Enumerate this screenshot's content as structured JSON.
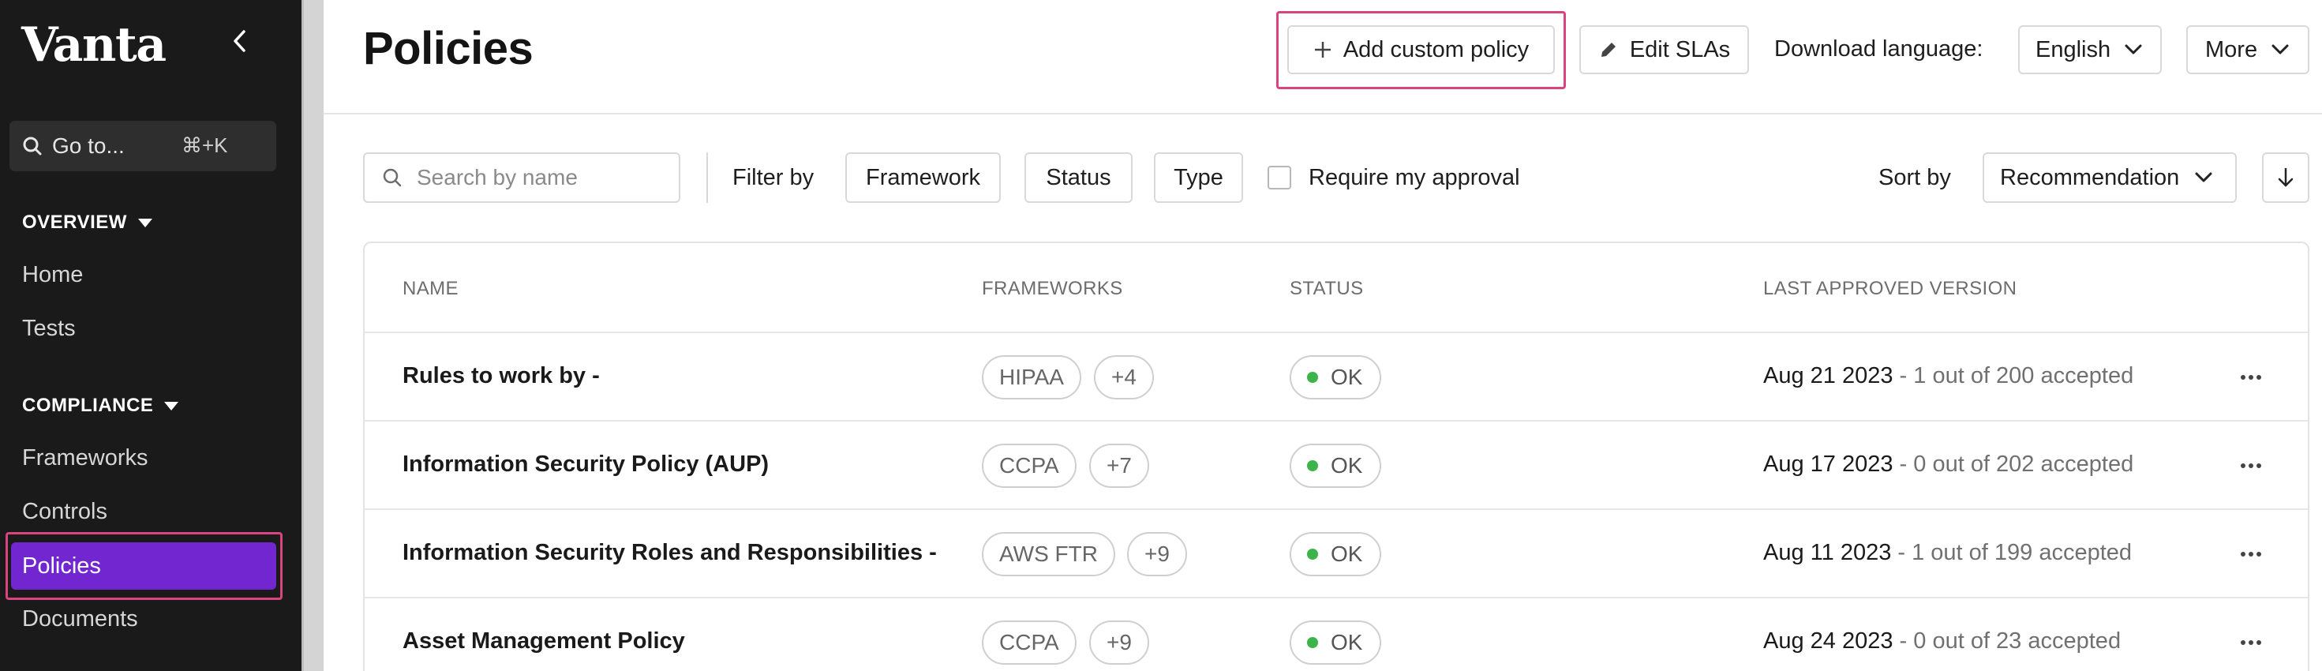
{
  "app": {
    "logo": "Vanta"
  },
  "sidebar": {
    "goto": {
      "label": "Go to...",
      "shortcut": "⌘+K"
    },
    "overview": {
      "title": "OVERVIEW",
      "items": [
        "Home",
        "Tests"
      ]
    },
    "compliance": {
      "title": "COMPLIANCE",
      "items": [
        "Frameworks",
        "Controls",
        "Policies",
        "Documents"
      ]
    },
    "active_item": "Policies"
  },
  "header": {
    "title": "Policies",
    "add_custom_policy": "Add custom policy",
    "edit_slas": "Edit SLAs",
    "download_language_label": "Download language:",
    "language": "English",
    "more": "More"
  },
  "toolbar": {
    "search_placeholder": "Search by name",
    "filter_by": "Filter by",
    "filters": [
      "Framework",
      "Status",
      "Type"
    ],
    "require_approval": "Require my approval",
    "sort_by": "Sort by",
    "sort_value": "Recommendation"
  },
  "table": {
    "columns": {
      "name": "NAME",
      "frameworks": "FRAMEWORKS",
      "status": "STATUS",
      "last_approved": "LAST APPROVED VERSION"
    },
    "rows": [
      {
        "name": "Rules to work by -",
        "framework": "HIPAA",
        "more": "+4",
        "status": "OK",
        "date": "Aug 21 2023",
        "detail": " - 1 out of 200 accepted"
      },
      {
        "name": "Information Security Policy (AUP)",
        "framework": "CCPA",
        "more": "+7",
        "status": "OK",
        "date": "Aug 17 2023",
        "detail": " - 0 out of 202 accepted"
      },
      {
        "name": "Information Security Roles and Responsibilities -",
        "framework": "AWS FTR",
        "more": "+9",
        "status": "OK",
        "date": "Aug 11 2023",
        "detail": " - 1 out of 199 accepted"
      },
      {
        "name": "Asset Management Policy",
        "framework": "CCPA",
        "more": "+9",
        "status": "OK",
        "date": "Aug 24 2023",
        "detail": " - 0 out of 23 accepted"
      }
    ]
  },
  "colors": {
    "sidebar_bg": "#1a1a1a",
    "active_nav": "#7226d0",
    "highlight": "#d9447e",
    "status_ok": "#3bb54a"
  }
}
